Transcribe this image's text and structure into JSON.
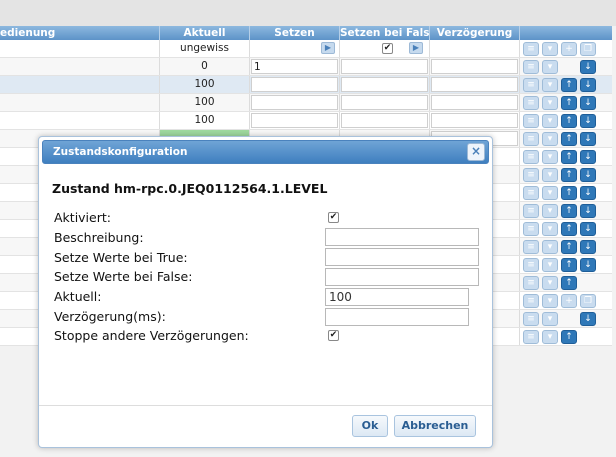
{
  "grid": {
    "headers": [
      "edienung",
      "Aktuell",
      "Setzen",
      "Setzen bei False",
      "Verzögerung"
    ],
    "rows": [
      {
        "aktuell": "ungewiss"
      },
      {
        "aktuell": "0",
        "setzen": "1"
      },
      {
        "aktuell": "100"
      },
      {
        "aktuell": "100"
      },
      {
        "aktuell": "100"
      }
    ]
  },
  "dialog": {
    "title": "Zustandskonfiguration",
    "close_glyph": "×",
    "heading": "Zustand hm-rpc.0.JEQ0112564.1.LEVEL",
    "fields": {
      "aktiviert": {
        "label": "Aktiviert:",
        "checked": true
      },
      "beschreibung": {
        "label": "Beschreibung:",
        "value": ""
      },
      "true_values": {
        "label": "Setze Werte bei True:",
        "value": ""
      },
      "false_values": {
        "label": "Setze Werte bei False:",
        "value": ""
      },
      "aktuell": {
        "label": "Aktuell:",
        "value": "100"
      },
      "verzoegerung": {
        "label": "Verzögerung(ms):",
        "value": ""
      },
      "stoppe": {
        "label": "Stoppe andere Verzögerungen:",
        "checked": true
      }
    },
    "buttons": {
      "ok": "Ok",
      "cancel": "Abbrechen"
    }
  },
  "colors": {
    "header_blue": "#5d93c8",
    "title_blue": "#3f7fbf",
    "highlight_green": "#9fd99f",
    "button_text": "#2a5d92"
  }
}
